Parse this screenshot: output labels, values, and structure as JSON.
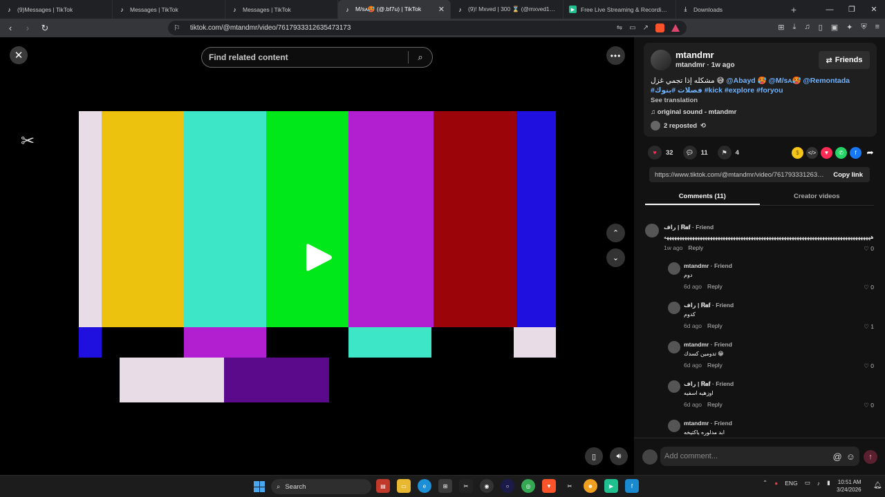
{
  "browser": {
    "tabs": [
      {
        "label": "(9)Messages | TikTok",
        "icon": "tiktok-icon",
        "active": false
      },
      {
        "label": "Messages | TikTok",
        "icon": "tiktok-icon",
        "active": false
      },
      {
        "label": "Messages | TikTok",
        "icon": "tiktok-icon",
        "active": false
      },
      {
        "label": "M/sᴀ🥵 (@.bf7u) | TikTok",
        "icon": "tiktok-icon",
        "active": true
      },
      {
        "label": "(9)! Mxved | 300 ⌛ (@mxved1) | TikTok",
        "icon": "tiktok-icon",
        "active": false
      },
      {
        "label": "Free Live Streaming & Recording Software",
        "icon": "streaming-icon",
        "active": false
      },
      {
        "label": "Downloads",
        "icon": "download-icon",
        "active": false
      }
    ],
    "url": "tiktok.com/@mtandmr/video/7617933312635473173"
  },
  "video": {
    "search_placeholder": "Find related content",
    "watermark": "CapCut",
    "colors": {
      "white": "#e8dde6",
      "yellow": "#ecc20f",
      "cyan": "#3ee6c8",
      "green": "#00e81a",
      "magenta": "#b21fd0",
      "red": "#9b0509",
      "blue": "#2010e0",
      "purple": "#5a0a8a"
    }
  },
  "post": {
    "author": "mtandmr",
    "author_sub": "mtandmr · 1w ago",
    "friends_label": "Friends",
    "caption_text": "مشكله إذا تجمي غزل 😅",
    "caption_tags": "@Abayd 🥵 @M/sᴀ🥵 @Remontada #فصلات #بنوك #kick #explore #foryou",
    "see_translation": "See translation",
    "sound": "original sound - mtandmr",
    "reposted": "2 reposted",
    "likes": "32",
    "comments_count": "11",
    "saves": "4",
    "link": "https://www.tiktok.com/@mtandmr/video/7617933312635473173",
    "copy_link": "Copy link",
    "tabs": [
      "Comments (11)",
      "Creator videos"
    ]
  },
  "comments": [
    {
      "name": "راف | 𝐑𝐚𝐟",
      "badge": "Friend",
      "text": "هههههههههههههههههههههههههههههههههههههههههههههههههههههههههههههههههههههههههههههههههه",
      "time": "1w ago",
      "reply": "Reply",
      "likes": "0",
      "indent": false
    },
    {
      "name": "mtandmr",
      "badge": "Friend",
      "text": "دوم",
      "time": "6d ago",
      "reply": "Reply",
      "likes": "0",
      "indent": true
    },
    {
      "name": "راف | 𝐑𝐚𝐟",
      "badge": "Friend",
      "text": "كدوم",
      "time": "6d ago",
      "reply": "Reply",
      "likes": "1",
      "indent": true
    },
    {
      "name": "mtandmr",
      "badge": "Friend",
      "text": "تدومين كسدك 😁",
      "time": "6d ago",
      "reply": "Reply",
      "likes": "0",
      "indent": true
    },
    {
      "name": "راف | 𝐑𝐚𝐟",
      "badge": "Friend",
      "text": "اوزهيه اسفيه",
      "time": "6d ago",
      "reply": "Reply",
      "likes": "0",
      "indent": true
    },
    {
      "name": "mtandmr",
      "badge": "Friend",
      "text": "ابد مدلوره ياكتيخه",
      "time": "",
      "reply": "",
      "likes": "",
      "indent": true
    }
  ],
  "add_comment_placeholder": "Add comment...",
  "taskbar": {
    "search_label": "Search",
    "lang": "ENG",
    "time": "10:51 AM",
    "date": "3/24/2026"
  }
}
